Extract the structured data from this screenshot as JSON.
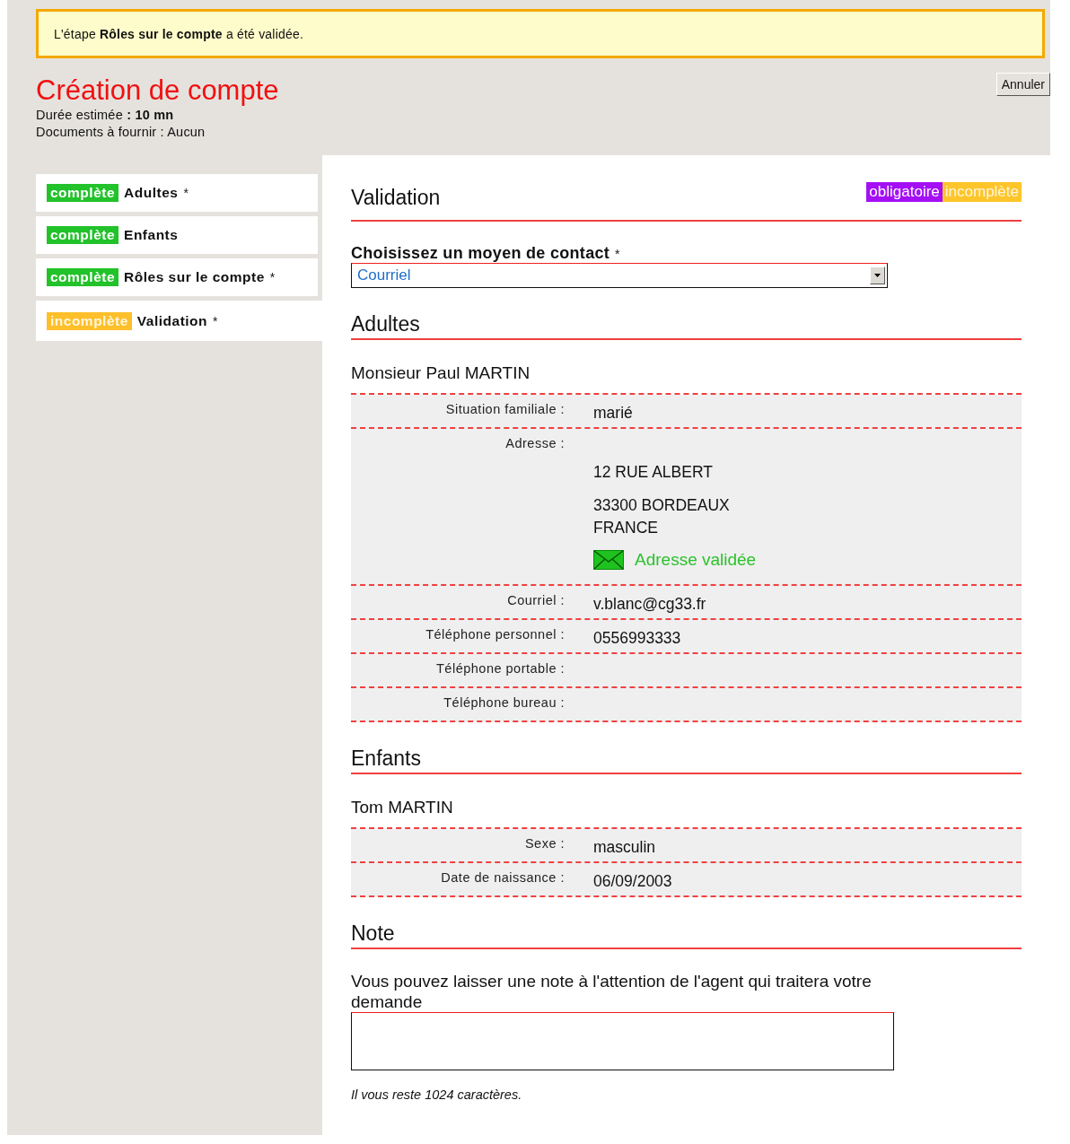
{
  "notice": {
    "text": "L'étape **Rôles sur le compte** a été validée."
  },
  "header": {
    "title": "Création de compte",
    "duration": "Durée estimée **: 10 mn**",
    "documents": "Documents à fournir : Aucun",
    "cancel": "Annuler"
  },
  "steps": [
    {
      "status": "complète",
      "kind": "complete",
      "label": "Adultes",
      "mark": "*",
      "selected": false
    },
    {
      "status": "complète",
      "kind": "complete",
      "label": "Enfants",
      "selected": false
    },
    {
      "status": "complète",
      "kind": "complete",
      "label": "Rôles sur le compte",
      "mark": "*",
      "selected": false
    },
    {
      "status": "incomplète",
      "kind": "incomplete",
      "label": "Validation",
      "mark": "*",
      "selected": true
    }
  ],
  "panel": {
    "title": "Validation",
    "badges": [
      {
        "text": "obligatoire",
        "kind": "required"
      },
      {
        "text": "incomplète",
        "kind": "incomplete"
      }
    ],
    "contact": {
      "label": "Choisissez un moyen de contact",
      "mark": "*",
      "value": "Courriel"
    },
    "sections": [
      {
        "title": "Adultes",
        "person": "Monsieur Paul MARTIN",
        "fields": [
          {
            "kind": "text",
            "label": "Situation familiale :",
            "value": "marié"
          },
          {
            "kind": "address",
            "label": "Adresse :",
            "lines": [
              "12 RUE ALBERT",
              "33300 BORDEAUX",
              "FRANCE"
            ],
            "verified": "Adresse validée"
          },
          {
            "kind": "text",
            "label": "Courriel :",
            "value": "v.blanc@cg33.fr"
          },
          {
            "kind": "text",
            "label": "Téléphone personnel :",
            "value": "0556993333"
          },
          {
            "kind": "text",
            "label": "Téléphone portable :"
          },
          {
            "kind": "text",
            "label": "Téléphone bureau :"
          }
        ]
      },
      {
        "title": "Enfants",
        "person": "Tom MARTIN",
        "fields": [
          {
            "kind": "text",
            "label": "Sexe :",
            "value": "masculin"
          },
          {
            "kind": "text",
            "label": "Date de naissance :",
            "value": "06/09/2003"
          }
        ]
      }
    ],
    "note": {
      "title": "Note",
      "hint": "Vous pouvez laisser une note à l'attention de l'agent qui traitera votre demande",
      "counter": "Il vous reste 1024 caractères."
    }
  }
}
